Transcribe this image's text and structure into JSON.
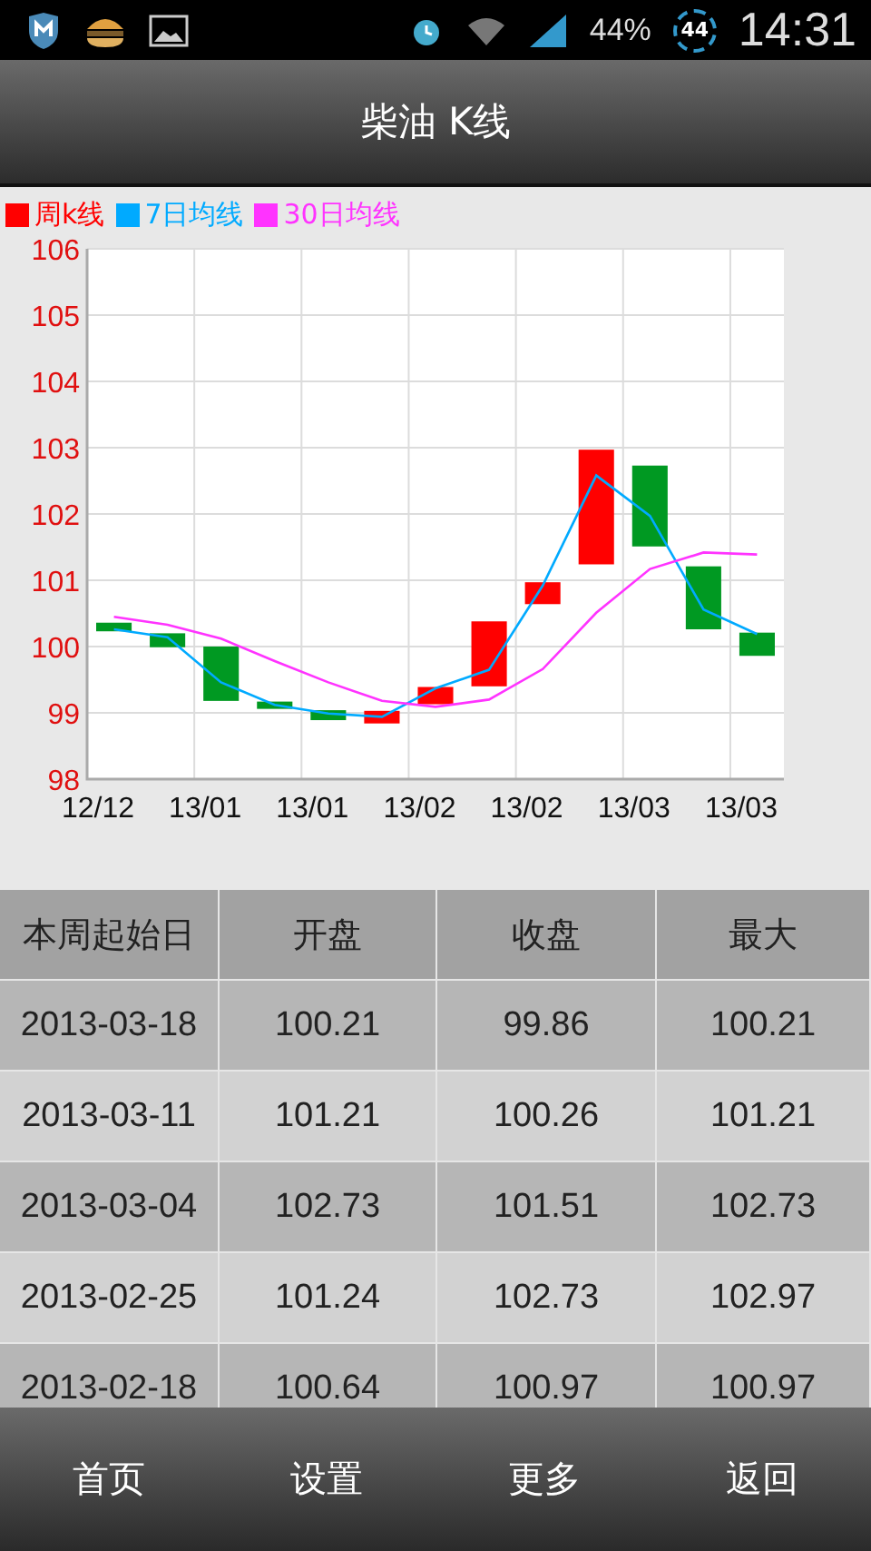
{
  "status_bar": {
    "battery": "44%",
    "badge": "44",
    "time": "14:31"
  },
  "title_bar": {
    "title": "柴油 K线"
  },
  "chart_data": {
    "type": "candlestick",
    "grid": true,
    "ylim": [
      98,
      106
    ],
    "yticks": [
      98,
      99,
      100,
      101,
      102,
      103,
      104,
      105,
      106
    ],
    "categories": [
      "12/12",
      null,
      "13/01",
      null,
      "13/01",
      null,
      "13/02",
      null,
      "13/02",
      null,
      "13/03",
      null,
      "13/03"
    ],
    "series": [
      {
        "name": "周k线",
        "color": "#ff0000",
        "colors": [
          "#009922",
          "#009922",
          "#009922",
          "#009922",
          "#009922",
          "#ff0000",
          "#ff0000",
          "#ff0000",
          "#ff0000",
          "#ff0000",
          "#009922",
          "#009922",
          "#009922"
        ],
        "ohlc": [
          [
            100.36,
            100.36,
            100.23,
            100.23
          ],
          [
            100.2,
            100.2,
            99.99,
            99.99
          ],
          [
            100.0,
            100.0,
            99.18,
            99.18
          ],
          [
            99.17,
            99.17,
            99.06,
            99.06
          ],
          [
            99.04,
            99.04,
            98.89,
            98.89
          ],
          [
            98.84,
            99.03,
            98.84,
            99.03
          ],
          [
            99.13,
            99.39,
            99.13,
            99.39
          ],
          [
            99.4,
            100.38,
            99.4,
            100.38
          ],
          [
            100.64,
            100.97,
            100.64,
            100.97
          ],
          [
            101.24,
            102.97,
            101.24,
            102.97
          ],
          [
            102.73,
            102.73,
            101.51,
            101.51
          ],
          [
            101.21,
            101.21,
            100.26,
            100.26
          ],
          [
            100.21,
            100.21,
            99.86,
            99.86
          ]
        ]
      },
      {
        "name": "7日均线",
        "type": "line",
        "color": "#00aaff",
        "values": [
          100.26,
          100.14,
          99.46,
          99.12,
          98.99,
          98.94,
          99.37,
          99.65,
          100.92,
          102.58,
          101.97,
          100.56,
          100.19
        ]
      },
      {
        "name": "30日均线",
        "type": "line",
        "color": "#ff33ff",
        "values": [
          100.45,
          100.33,
          100.12,
          99.78,
          99.46,
          99.18,
          99.09,
          99.2,
          99.66,
          100.51,
          101.17,
          101.42,
          101.39
        ]
      }
    ]
  },
  "table": {
    "columns": [
      "本周起始日",
      "开盘",
      "收盘",
      "最大"
    ],
    "rows": [
      [
        "2013-03-18",
        "100.21",
        "99.86",
        "100.21"
      ],
      [
        "2013-03-11",
        "101.21",
        "100.26",
        "101.21"
      ],
      [
        "2013-03-04",
        "102.73",
        "101.51",
        "102.73"
      ],
      [
        "2013-02-25",
        "101.24",
        "102.73",
        "102.97"
      ],
      [
        "2013-02-18",
        "100.64",
        "100.97",
        "100.97"
      ]
    ]
  },
  "bottom_bar": [
    {
      "label": "首页"
    },
    {
      "label": "设置"
    },
    {
      "label": "更多"
    },
    {
      "label": "返回"
    }
  ]
}
